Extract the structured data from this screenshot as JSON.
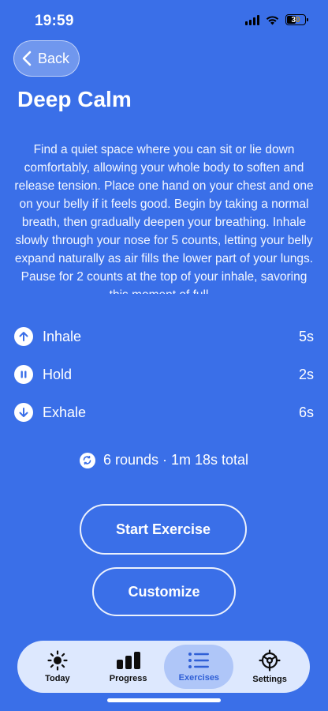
{
  "status_bar": {
    "time": "19:59",
    "battery": "30"
  },
  "back_label": "Back",
  "title": "Deep Calm",
  "description": "Find a quiet space where you can sit or lie down comfortably, allowing your whole body to soften and release tension. Place one hand on your chest and one on your belly if it feels good. Begin by taking a normal breath, then gradually deepen your breathing. Inhale slowly through your nose for 5 counts, letting your belly expand naturally as air fills the lower part of your lungs. Pause for 2 counts at the top of your inhale, savoring this moment of full...",
  "phases": [
    {
      "label": "Inhale",
      "duration": "5s",
      "icon": "arrow-up-icon"
    },
    {
      "label": "Hold",
      "duration": "2s",
      "icon": "pause-icon"
    },
    {
      "label": "Exhale",
      "duration": "6s",
      "icon": "arrow-down-icon"
    }
  ],
  "summary": "6 rounds · 1m 18s total",
  "buttons": {
    "start": "Start Exercise",
    "customize": "Customize"
  },
  "tabs": [
    {
      "label": "Today",
      "icon": "sun-icon",
      "active": false
    },
    {
      "label": "Progress",
      "icon": "bar-chart-icon",
      "active": false
    },
    {
      "label": "Exercises",
      "icon": "list-icon",
      "active": true
    },
    {
      "label": "Settings",
      "icon": "gear-icon",
      "active": false
    }
  ],
  "colors": {
    "background": "#3a6fe8",
    "accent": "#2f5fd6"
  }
}
